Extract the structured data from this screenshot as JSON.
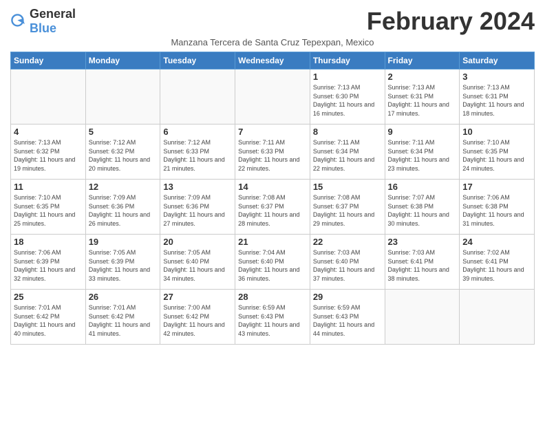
{
  "header": {
    "logo_general": "General",
    "logo_blue": "Blue",
    "month_title": "February 2024",
    "subtitle": "Manzana Tercera de Santa Cruz Tepexpan, Mexico"
  },
  "weekdays": [
    "Sunday",
    "Monday",
    "Tuesday",
    "Wednesday",
    "Thursday",
    "Friday",
    "Saturday"
  ],
  "weeks": [
    [
      {
        "day": "",
        "info": ""
      },
      {
        "day": "",
        "info": ""
      },
      {
        "day": "",
        "info": ""
      },
      {
        "day": "",
        "info": ""
      },
      {
        "day": "1",
        "info": "Sunrise: 7:13 AM\nSunset: 6:30 PM\nDaylight: 11 hours and 16 minutes."
      },
      {
        "day": "2",
        "info": "Sunrise: 7:13 AM\nSunset: 6:31 PM\nDaylight: 11 hours and 17 minutes."
      },
      {
        "day": "3",
        "info": "Sunrise: 7:13 AM\nSunset: 6:31 PM\nDaylight: 11 hours and 18 minutes."
      }
    ],
    [
      {
        "day": "4",
        "info": "Sunrise: 7:13 AM\nSunset: 6:32 PM\nDaylight: 11 hours and 19 minutes."
      },
      {
        "day": "5",
        "info": "Sunrise: 7:12 AM\nSunset: 6:32 PM\nDaylight: 11 hours and 20 minutes."
      },
      {
        "day": "6",
        "info": "Sunrise: 7:12 AM\nSunset: 6:33 PM\nDaylight: 11 hours and 21 minutes."
      },
      {
        "day": "7",
        "info": "Sunrise: 7:11 AM\nSunset: 6:33 PM\nDaylight: 11 hours and 22 minutes."
      },
      {
        "day": "8",
        "info": "Sunrise: 7:11 AM\nSunset: 6:34 PM\nDaylight: 11 hours and 22 minutes."
      },
      {
        "day": "9",
        "info": "Sunrise: 7:11 AM\nSunset: 6:34 PM\nDaylight: 11 hours and 23 minutes."
      },
      {
        "day": "10",
        "info": "Sunrise: 7:10 AM\nSunset: 6:35 PM\nDaylight: 11 hours and 24 minutes."
      }
    ],
    [
      {
        "day": "11",
        "info": "Sunrise: 7:10 AM\nSunset: 6:35 PM\nDaylight: 11 hours and 25 minutes."
      },
      {
        "day": "12",
        "info": "Sunrise: 7:09 AM\nSunset: 6:36 PM\nDaylight: 11 hours and 26 minutes."
      },
      {
        "day": "13",
        "info": "Sunrise: 7:09 AM\nSunset: 6:36 PM\nDaylight: 11 hours and 27 minutes."
      },
      {
        "day": "14",
        "info": "Sunrise: 7:08 AM\nSunset: 6:37 PM\nDaylight: 11 hours and 28 minutes."
      },
      {
        "day": "15",
        "info": "Sunrise: 7:08 AM\nSunset: 6:37 PM\nDaylight: 11 hours and 29 minutes."
      },
      {
        "day": "16",
        "info": "Sunrise: 7:07 AM\nSunset: 6:38 PM\nDaylight: 11 hours and 30 minutes."
      },
      {
        "day": "17",
        "info": "Sunrise: 7:06 AM\nSunset: 6:38 PM\nDaylight: 11 hours and 31 minutes."
      }
    ],
    [
      {
        "day": "18",
        "info": "Sunrise: 7:06 AM\nSunset: 6:39 PM\nDaylight: 11 hours and 32 minutes."
      },
      {
        "day": "19",
        "info": "Sunrise: 7:05 AM\nSunset: 6:39 PM\nDaylight: 11 hours and 33 minutes."
      },
      {
        "day": "20",
        "info": "Sunrise: 7:05 AM\nSunset: 6:40 PM\nDaylight: 11 hours and 34 minutes."
      },
      {
        "day": "21",
        "info": "Sunrise: 7:04 AM\nSunset: 6:40 PM\nDaylight: 11 hours and 36 minutes."
      },
      {
        "day": "22",
        "info": "Sunrise: 7:03 AM\nSunset: 6:40 PM\nDaylight: 11 hours and 37 minutes."
      },
      {
        "day": "23",
        "info": "Sunrise: 7:03 AM\nSunset: 6:41 PM\nDaylight: 11 hours and 38 minutes."
      },
      {
        "day": "24",
        "info": "Sunrise: 7:02 AM\nSunset: 6:41 PM\nDaylight: 11 hours and 39 minutes."
      }
    ],
    [
      {
        "day": "25",
        "info": "Sunrise: 7:01 AM\nSunset: 6:42 PM\nDaylight: 11 hours and 40 minutes."
      },
      {
        "day": "26",
        "info": "Sunrise: 7:01 AM\nSunset: 6:42 PM\nDaylight: 11 hours and 41 minutes."
      },
      {
        "day": "27",
        "info": "Sunrise: 7:00 AM\nSunset: 6:42 PM\nDaylight: 11 hours and 42 minutes."
      },
      {
        "day": "28",
        "info": "Sunrise: 6:59 AM\nSunset: 6:43 PM\nDaylight: 11 hours and 43 minutes."
      },
      {
        "day": "29",
        "info": "Sunrise: 6:59 AM\nSunset: 6:43 PM\nDaylight: 11 hours and 44 minutes."
      },
      {
        "day": "",
        "info": ""
      },
      {
        "day": "",
        "info": ""
      }
    ]
  ]
}
